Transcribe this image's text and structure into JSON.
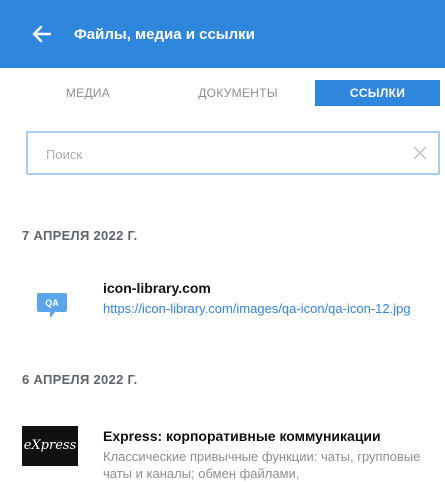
{
  "header": {
    "title": "Файлы, медиа и ссылки",
    "back_icon": "arrow-left-icon"
  },
  "tabs": [
    {
      "label": "МЕДИА",
      "active": false
    },
    {
      "label": "ДОКУМЕНТЫ",
      "active": false
    },
    {
      "label": "ССЫЛКИ",
      "active": true
    }
  ],
  "search": {
    "placeholder": "Поиск",
    "value": "",
    "clear_icon": "close-icon"
  },
  "groups": [
    {
      "date": "7 АПРЕЛЯ 2022 Г.",
      "items": [
        {
          "title": "icon-library.com",
          "url": "https://icon-library.com/images/qa-icon/qa-icon-12.jpg",
          "icon": "qa-chat-icon",
          "icon_text": "QA"
        }
      ]
    },
    {
      "date": "6 АПРЕЛЯ 2022 Г.",
      "items": [
        {
          "title": "Express: корпоративные коммуникации",
          "description": "Классические привычные функции: чаты, групповые чаты и каналы; обмен файлами,",
          "icon": "express-logo",
          "logo_text": "eXpress"
        }
      ]
    }
  ],
  "colors": {
    "accent": "#2f86dd",
    "header_bg": "#2f86dd"
  }
}
